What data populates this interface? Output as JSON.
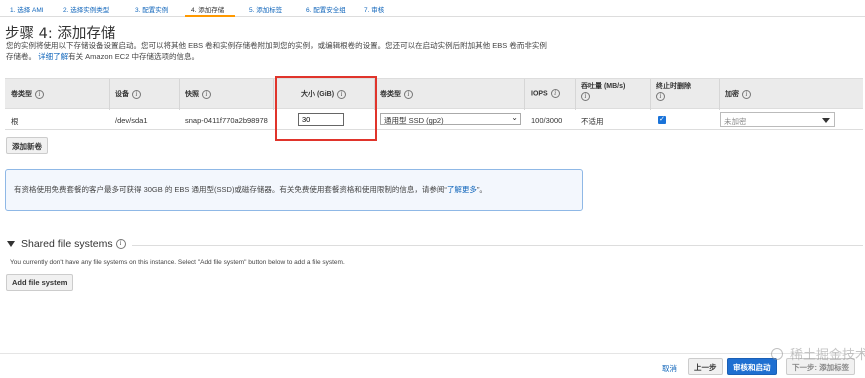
{
  "tabs": [
    {
      "label": "1. 选择 AMI"
    },
    {
      "label": "2. 选择实例类型"
    },
    {
      "label": "3. 配置实例"
    },
    {
      "label": "4. 添加存储"
    },
    {
      "label": "5. 添加标签"
    },
    {
      "label": "6. 配置安全组"
    },
    {
      "label": "7. 审核"
    }
  ],
  "title": "步骤 4: 添加存储",
  "description": {
    "line1": "您的实例将使用以下存储设备设置启动。您可以将其他 EBS 卷和实例存储卷附加到您的实例，或编辑根卷的设置。您还可以在启动实例后附加其他 EBS 卷而非实例",
    "line2_prefix": "存储卷。",
    "link": "详细了解",
    "line2_suffix": "有关 Amazon EC2 中存储选项的信息。"
  },
  "table": {
    "headers": {
      "volume_type": "卷类型",
      "device": "设备",
      "snapshot": "快照",
      "size": "大小 (GiB)",
      "volume_kind": "卷类型",
      "iops": "IOPS",
      "throughput": "吞吐量 (MB/s)",
      "delete_on_termination": "终止时删除",
      "encryption": "加密"
    },
    "row": {
      "volume_type": "根",
      "device": "/dev/sda1",
      "snapshot": "snap-0411f770a2b98978",
      "size": "30",
      "volume_kind": "通用型 SSD (gp2)",
      "iops": "100/3000",
      "throughput": "不适用",
      "delete_on_termination": true,
      "encryption": "未加密"
    }
  },
  "add_volume_label": "添加新卷",
  "notice": {
    "text": "有资格使用免费套餐的客户最多可获得 30GB 的 EBS 通用型(SSD)或磁存储器。有关免费使用套餐资格和使用限制的信息，请参阅“",
    "link": "了解更多",
    "suffix": "”。"
  },
  "shared_fs": {
    "title": "Shared file systems",
    "text": "You currently don't have any file systems on this instance. Select \"Add file system\" button below to add a file system.",
    "button": "Add file system"
  },
  "footer": {
    "cancel": "取消",
    "previous": "上一步",
    "review": "审核和启动",
    "next": "下一步: 添加标签"
  },
  "watermark": "稀土掘金技术社区",
  "colors": {
    "link": "#1166bb",
    "primary_button": "#1f6fd1",
    "highlight_box": "#e0342b",
    "active_tab": "#ff9900"
  }
}
